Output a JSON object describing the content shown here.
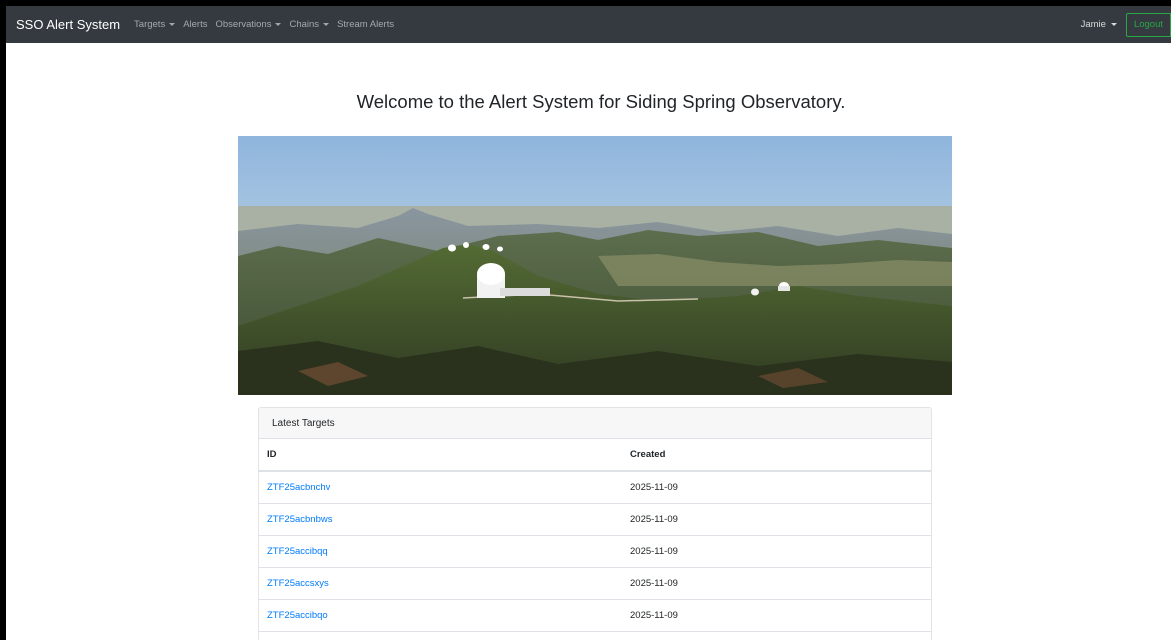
{
  "navbar": {
    "brand": "SSO Alert System",
    "items": [
      {
        "label": "Targets",
        "dropdown": true
      },
      {
        "label": "Alerts",
        "dropdown": false
      },
      {
        "label": "Observations",
        "dropdown": true
      },
      {
        "label": "Chains",
        "dropdown": true
      },
      {
        "label": "Stream Alerts",
        "dropdown": false
      }
    ],
    "user": "Jamie",
    "logout": "Logout"
  },
  "welcome": "Welcome to the Alert System for Siding Spring Observatory.",
  "latest_targets": {
    "title": "Latest Targets",
    "columns": [
      "ID",
      "Created"
    ],
    "rows": [
      {
        "id": "ZTF25acbnchv",
        "created": "2025-11-09"
      },
      {
        "id": "ZTF25acbnbws",
        "created": "2025-11-09"
      },
      {
        "id": "ZTF25accibqq",
        "created": "2025-11-09"
      },
      {
        "id": "ZTF25accsxys",
        "created": "2025-11-09"
      },
      {
        "id": "ZTF25accibqo",
        "created": "2025-11-09"
      }
    ]
  },
  "colors": {
    "navbar": "#343a40",
    "link": "#007bff",
    "logout": "#28a745"
  }
}
